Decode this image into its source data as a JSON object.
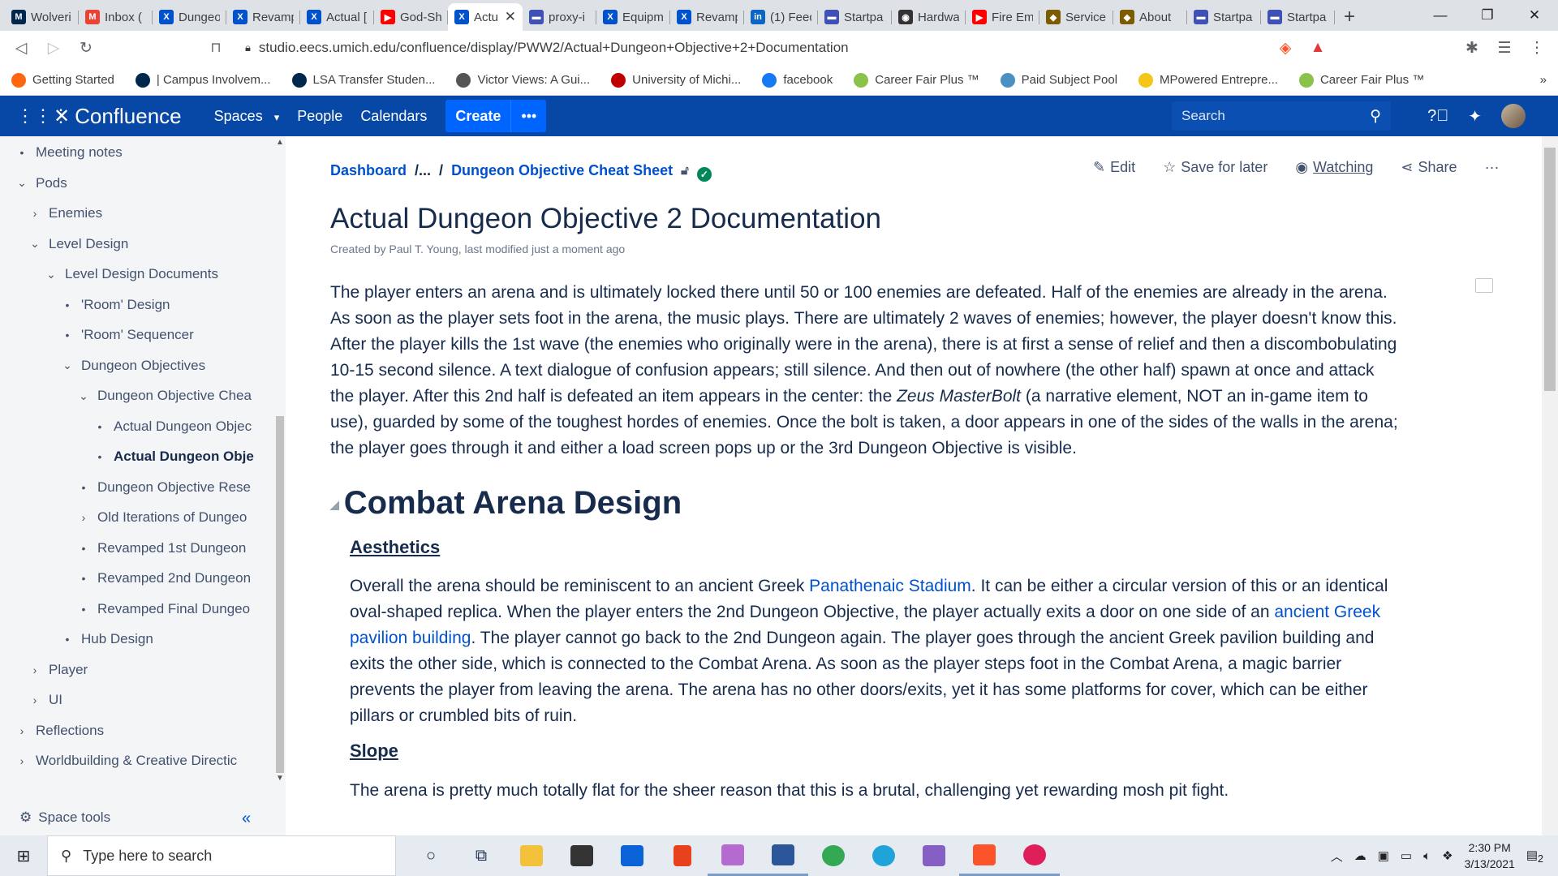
{
  "browser": {
    "tabs": [
      {
        "label": "Wolveri",
        "fav": "M",
        "color": "#00274c"
      },
      {
        "label": "Inbox (",
        "fav": "M",
        "color": "#ea4335"
      },
      {
        "label": "Dungeo",
        "fav": "X",
        "color": "#0052cc"
      },
      {
        "label": "Revamp",
        "fav": "X",
        "color": "#0052cc"
      },
      {
        "label": "Actual [",
        "fav": "X",
        "color": "#0052cc"
      },
      {
        "label": "God-Sh",
        "fav": "▶",
        "color": "#ff0000"
      },
      {
        "label": "Actu",
        "fav": "X",
        "color": "#0052cc",
        "active": true
      },
      {
        "label": "proxy-i",
        "fav": "▬",
        "color": "#3f51b5"
      },
      {
        "label": "Equipm",
        "fav": "X",
        "color": "#0052cc"
      },
      {
        "label": "Revamp",
        "fav": "X",
        "color": "#0052cc"
      },
      {
        "label": "(1) Feed",
        "fav": "in",
        "color": "#0a66c2"
      },
      {
        "label": "Startpa",
        "fav": "▬",
        "color": "#3f51b5"
      },
      {
        "label": "Hardwa",
        "fav": "◉",
        "color": "#333333"
      },
      {
        "label": "Fire Em",
        "fav": "▶",
        "color": "#ff0000"
      },
      {
        "label": "Service",
        "fav": "◆",
        "color": "#7b5c00"
      },
      {
        "label": "About",
        "fav": "◆",
        "color": "#7b5c00"
      },
      {
        "label": "Startpa",
        "fav": "▬",
        "color": "#3f51b5"
      },
      {
        "label": "Startpa",
        "fav": "▬",
        "color": "#3f51b5"
      }
    ],
    "url": "studio.eecs.umich.edu/confluence/display/PWW2/Actual+Dungeon+Objective+2+Documentation",
    "bookmarks": [
      {
        "label": "Getting Started",
        "color": "#ff6611"
      },
      {
        "label": "| Campus Involvem...",
        "color": "#00274c"
      },
      {
        "label": "LSA Transfer Studen...",
        "color": "#00274c"
      },
      {
        "label": "Victor Views: A Gui...",
        "color": "#555555"
      },
      {
        "label": "University of Michi...",
        "color": "#c00000"
      },
      {
        "label": "facebook",
        "color": "#1877f2"
      },
      {
        "label": "Career Fair Plus ™",
        "color": "#8bc34a"
      },
      {
        "label": "Paid Subject Pool",
        "color": "#4a90c2"
      },
      {
        "label": "MPowered Entrepre...",
        "color": "#f5c518"
      },
      {
        "label": "Career Fair Plus ™",
        "color": "#8bc34a"
      }
    ]
  },
  "header": {
    "logo": "Confluence",
    "nav": [
      "Spaces",
      "People",
      "Calendars"
    ],
    "create": "Create",
    "search_placeholder": "Search"
  },
  "sidebar": {
    "items": [
      {
        "label": "Meeting notes",
        "marker": "•",
        "level": 0
      },
      {
        "label": "Pods",
        "marker": "⌄",
        "level": 0
      },
      {
        "label": "Enemies",
        "marker": "›",
        "level": 1
      },
      {
        "label": "Level Design",
        "marker": "⌄",
        "level": 1
      },
      {
        "label": "Level Design Documents",
        "marker": "⌄",
        "level": 2
      },
      {
        "label": "'Room' Design",
        "marker": "•",
        "level": 3
      },
      {
        "label": "'Room' Sequencer",
        "marker": "•",
        "level": 3
      },
      {
        "label": "Dungeon Objectives",
        "marker": "⌄",
        "level": 3
      },
      {
        "label": "Dungeon Objective Chea",
        "marker": "⌄",
        "level": 4
      },
      {
        "label": "Actual Dungeon Objec",
        "marker": "•",
        "level": 5
      },
      {
        "label": "Actual Dungeon Obje",
        "marker": "•",
        "level": 5,
        "bold": true
      },
      {
        "label": "Dungeon Objective Rese",
        "marker": "•",
        "level": 4
      },
      {
        "label": "Old Iterations of Dungeo",
        "marker": "›",
        "level": 4
      },
      {
        "label": "Revamped 1st Dungeon",
        "marker": "•",
        "level": 4
      },
      {
        "label": "Revamped 2nd Dungeon",
        "marker": "•",
        "level": 4
      },
      {
        "label": "Revamped Final Dungeo",
        "marker": "•",
        "level": 4
      },
      {
        "label": "Hub Design",
        "marker": "•",
        "level": 3
      },
      {
        "label": "Player",
        "marker": "›",
        "level": 1
      },
      {
        "label": "UI",
        "marker": "›",
        "level": 1
      },
      {
        "label": "Reflections",
        "marker": "›",
        "level": 0
      },
      {
        "label": "Worldbuilding & Creative Directic",
        "marker": "›",
        "level": 0
      }
    ],
    "space_tools": "Space tools"
  },
  "page": {
    "breadcrumb": {
      "root": "Dashboard",
      "ellipsis": "/...",
      "slash": "/",
      "parent": "Dungeon Objective Cheat Sheet"
    },
    "actions": {
      "edit": "Edit",
      "save": "Save for later",
      "watch": "Watching",
      "share": "Share",
      "more": "···"
    },
    "title": "Actual Dungeon Objective 2 Documentation",
    "byline": "Created by Paul T. Young, last modified just a moment ago",
    "intro_before": "The player enters an arena and is ultimately locked there until 50 or 100 enemies are defeated. Half of the enemies are already in the arena. As soon as the player sets foot in the arena, the music plays. There are ultimately 2 waves of enemies; however, the player doesn't know this. After the player kills the 1st wave (the enemies who originally were in the arena), there is at first a sense of relief and then a discombobulating 10-15 second silence. A text dialogue of confusion appears; still silence. And then out of nowhere (the other half) spawn at once and attack the player. After this 2nd half is defeated an item appears in the center: the ",
    "intro_em": "Zeus MasterBolt",
    "intro_after": " (a narrative element, NOT an in-game item to use), guarded by some of the toughest hordes of enemies. Once the bolt is taken, a door appears in one of the sides of the walls in the arena; the player goes through it and either a load screen pops up or the 3rd Dungeon Objective is visible.",
    "h1": "Combat Arena Design",
    "aesthetics_heading": "Aesthetics",
    "aes_1": "Overall the arena should be reminiscent to an ancient Greek ",
    "aes_link1": "Panathenaic Stadium",
    "aes_2": ". It can be either a circular version of this or an identical oval-shaped replica. When the player enters the 2nd Dungeon Objective, the player actually exits a door on one side of an ",
    "aes_link2": "ancient Greek pavilion building",
    "aes_3": ". The player cannot go back to the 2nd Dungeon again. The player goes through the ancient Greek pavilion building and exits the other side, which is connected to the Combat Arena. As soon as the player steps foot in the Combat Arena, a magic barrier prevents the player from leaving the arena. The arena has no other doors/exits, yet it has some platforms for cover, which can be either pillars or crumbled bits of ruin.",
    "slope_heading": "Slope",
    "slope_text": "The arena is pretty much totally flat for the sheer reason that this is a brutal, challenging yet rewarding mosh pit fight."
  },
  "taskbar": {
    "search_placeholder": "Type here to search",
    "time": "2:30 PM",
    "date": "3/13/2021",
    "notif_count": "2"
  }
}
